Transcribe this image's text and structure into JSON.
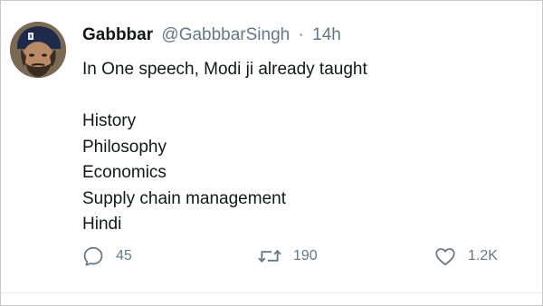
{
  "tweet": {
    "author": {
      "display_name": "Gabbbar",
      "handle": "@GabbbarSingh",
      "avatar_icon": "profile-avatar"
    },
    "separator": "·",
    "time": "14h",
    "text_lines": [
      "In One speech, Modi ji already taught",
      "",
      "History",
      "Philosophy",
      "Economics",
      "Supply chain management",
      "Hindi"
    ],
    "actions": {
      "reply": {
        "icon": "reply-icon",
        "count": "45"
      },
      "retweet": {
        "icon": "retweet-icon",
        "count": "190"
      },
      "like": {
        "icon": "heart-icon",
        "count": "1.2K"
      }
    }
  },
  "colors": {
    "text": "#14171a",
    "muted": "#657786",
    "divider": "#e6ecf0",
    "frame_border": "#c8c8c8"
  }
}
